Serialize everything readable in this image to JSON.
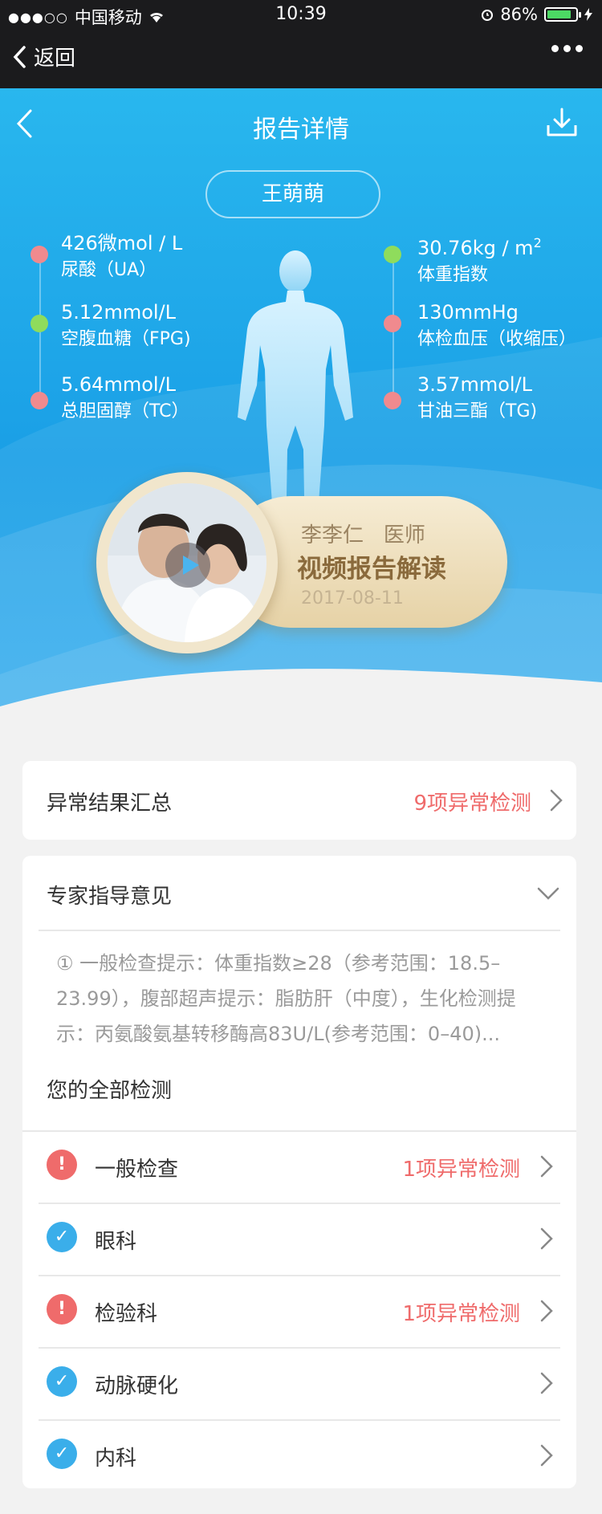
{
  "status_bar": {
    "signal": "●●●○○",
    "carrier": "中国移动",
    "time": "10:39",
    "battery": "86%",
    "battery_level": 0.86
  },
  "nav": {
    "back_label": "返回"
  },
  "header": {
    "title": "报告详情"
  },
  "patient": {
    "name": "王萌萌"
  },
  "metrics": {
    "left": [
      {
        "value": "426微mol / L",
        "label": "尿酸（UA）",
        "status": "red"
      },
      {
        "value": "5.12mmol/L",
        "label": "空腹血糖（FPG)",
        "status": "green"
      },
      {
        "value": "5.64mmol/L",
        "label": "总胆固醇（TC）",
        "status": "red"
      }
    ],
    "right": [
      {
        "value": "30.76kg / m",
        "sup": "2",
        "label": "体重指数",
        "status": "green"
      },
      {
        "value": "130mmHg",
        "label": "体检血压（收缩压）",
        "status": "red"
      },
      {
        "value": "3.57mmol/L",
        "label": "甘油三酯（TG)",
        "status": "red"
      }
    ]
  },
  "doctor": {
    "name": "李李仁",
    "role": "医师",
    "video_title": "视频报告解读",
    "date": "2017-08-11"
  },
  "summary": {
    "title": "异常结果汇总",
    "abnormal": "9项异常检测"
  },
  "expert": {
    "title": "专家指导意见",
    "text": "① 一般检查提示：体重指数≥28（参考范围：18.5–23.99），腹部超声提示：脂肪肝（中度），生化检测提示：丙氨酸氨基转移酶高83U/L(参考范围：0–40)..."
  },
  "all_tests": {
    "title": "您的全部检测",
    "items": [
      {
        "label": "一般检查",
        "status": "1项异常检测",
        "icon": "warning-icon"
      },
      {
        "label": "眼科",
        "status": "",
        "icon": "check-icon"
      },
      {
        "label": "检验科",
        "status": "1项异常检测",
        "icon": "warning-icon"
      },
      {
        "label": "动脉硬化",
        "status": "",
        "icon": "check-icon"
      },
      {
        "label": "内科",
        "status": "",
        "icon": "check-icon"
      }
    ]
  },
  "colors": {
    "header_blue": "#29b7ee",
    "abnormal_red": "#ef6b6b",
    "normal_green": "#8fdc5c",
    "check_blue": "#3aaeea",
    "gold": "#e6d2a6"
  }
}
